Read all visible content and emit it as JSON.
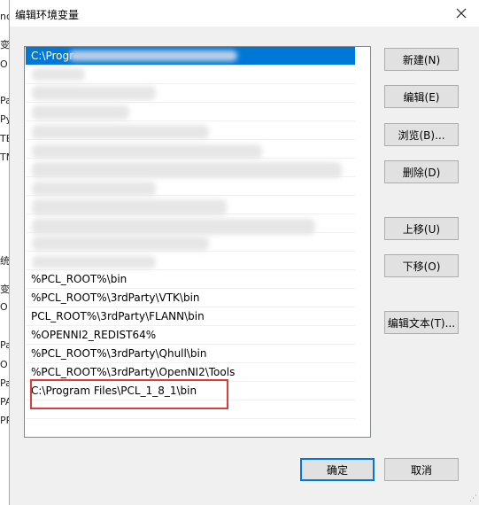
{
  "window": {
    "title": "编辑环境变量",
    "close_icon": "close-icon"
  },
  "background": {
    "left_chars": [
      "nc",
      "变",
      "O",
      "Pa",
      "Py",
      "TE",
      "TM",
      "统",
      "变",
      "O",
      "Pa",
      "O",
      "Pa",
      "PA",
      "PR"
    ]
  },
  "path_list": {
    "selected_prefix": "C:\\Progr",
    "visible_items": [
      "%PCL_ROOT%\\bin",
      "%PCL_ROOT%\\3rdParty\\VTK\\bin",
      "PCL_ROOT%\\3rdParty\\FLANN\\bin",
      "%OPENNI2_REDIST64%",
      "%PCL_ROOT%\\3rdParty\\Qhull\\bin",
      "%PCL_ROOT%\\3rdParty\\OpenNI2\\Tools",
      "C:\\Program Files\\PCL_1_8_1\\bin"
    ]
  },
  "buttons": {
    "new": "新建(N)",
    "edit": "编辑(E)",
    "browse": "浏览(B)...",
    "delete": "删除(D)",
    "move_up": "上移(U)",
    "move_down": "下移(O)",
    "edit_text": "编辑文本(T)...",
    "ok": "确定",
    "cancel": "取消"
  },
  "colors": {
    "selection": "#0078d7",
    "highlight_box": "#e03a3a"
  }
}
